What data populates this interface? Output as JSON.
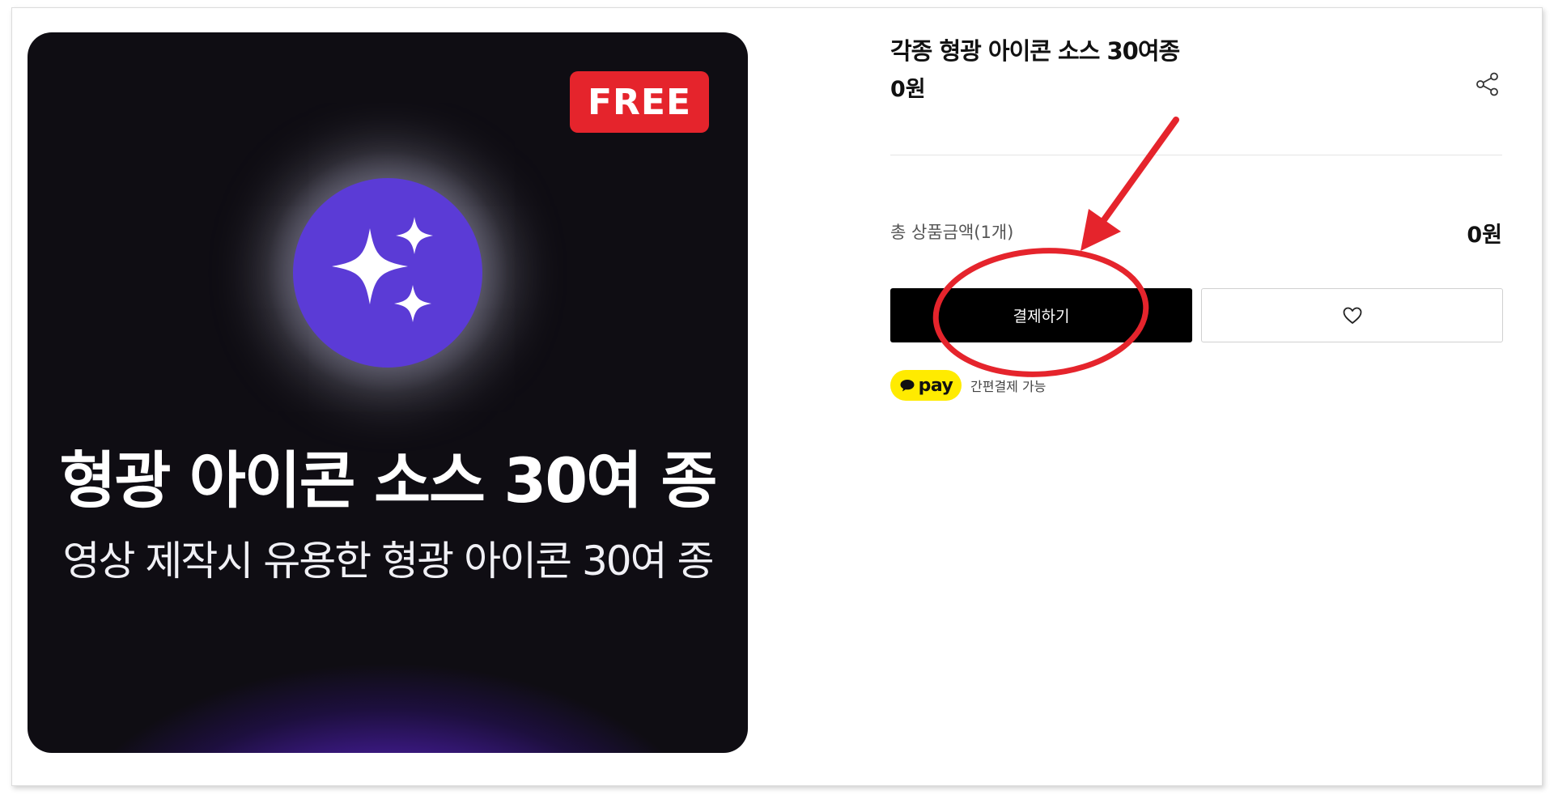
{
  "product_image": {
    "badge": "FREE",
    "headline": "형광 아이콘 소스 30여 종",
    "subline": "영상 제작시 유용한 형광 아이콘 30여 종",
    "icon": "sparkles-icon",
    "badge_color": "#e5242c",
    "circle_color": "#5b3bd6"
  },
  "product": {
    "title": "각종 형광 아이콘 소스 30여종",
    "price": "0원"
  },
  "summary": {
    "total_label": "총 상품금액(1개)",
    "total_value": "0원"
  },
  "actions": {
    "checkout_label": "결제하기",
    "wishlist_icon": "heart-icon",
    "share_icon": "share-icon"
  },
  "payment": {
    "pay_brand": "pay",
    "easy_pay_label": "간편결제 가능",
    "pay_badge_color": "#ffeb00"
  },
  "annotation": {
    "color": "#e5242c",
    "shapes": [
      "arrow",
      "circle"
    ]
  }
}
